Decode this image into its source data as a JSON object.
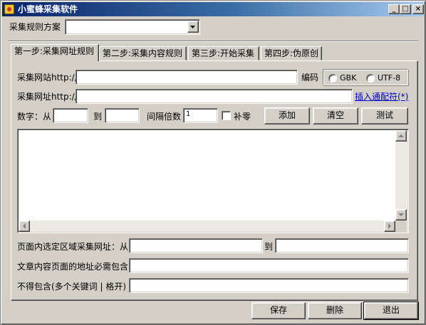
{
  "window": {
    "title": "小蜜蜂采集软件"
  },
  "titlebar_buttons": {
    "minimize": "_",
    "maximize": "□",
    "close": "×"
  },
  "scheme": {
    "label": "采集规则方案",
    "value": ""
  },
  "tabs": [
    {
      "label": "第一步:采集网址规则"
    },
    {
      "label": "第二步:采集内容规则"
    },
    {
      "label": "第三步:开始采集"
    },
    {
      "label": "第四步:伪原创"
    }
  ],
  "step1": {
    "site_label": "采集网站http://",
    "site_value": "",
    "encoding_label": "编码",
    "encoding_options": [
      "GBK",
      "UTF-8"
    ],
    "url_label": "采集网址http://",
    "url_value": "",
    "insert_wildcard": "插入通配符(*)",
    "num_from_label": "数字：从",
    "num_from_value": "",
    "num_to_label": "到",
    "num_to_value": "",
    "interval_label": "间隔倍数",
    "interval_value": "1",
    "pad_zero_label": "补零",
    "add_button": "添加",
    "clear_button": "清空",
    "test_button": "测试",
    "url_list_text": "",
    "region_label": "页面内选定区域采集网址：从",
    "region_from_value": "",
    "region_to_label": "到",
    "region_to_value": "",
    "must_contain_label": "文章内容页面的地址必需包含",
    "must_contain_value": "",
    "exclude_label": "不得包含(多个关键词 | 格开)",
    "exclude_value": ""
  },
  "footer": {
    "save": "保存",
    "delete": "删除",
    "exit": "退出"
  },
  "icons": {
    "app": "bee-app-icon",
    "dropdown": "triangle-down-icon"
  },
  "colors": {
    "titlebar_start": "#0a246a",
    "titlebar_end": "#a6caf0",
    "face": "#d4d0c8",
    "link": "#0000cc"
  }
}
